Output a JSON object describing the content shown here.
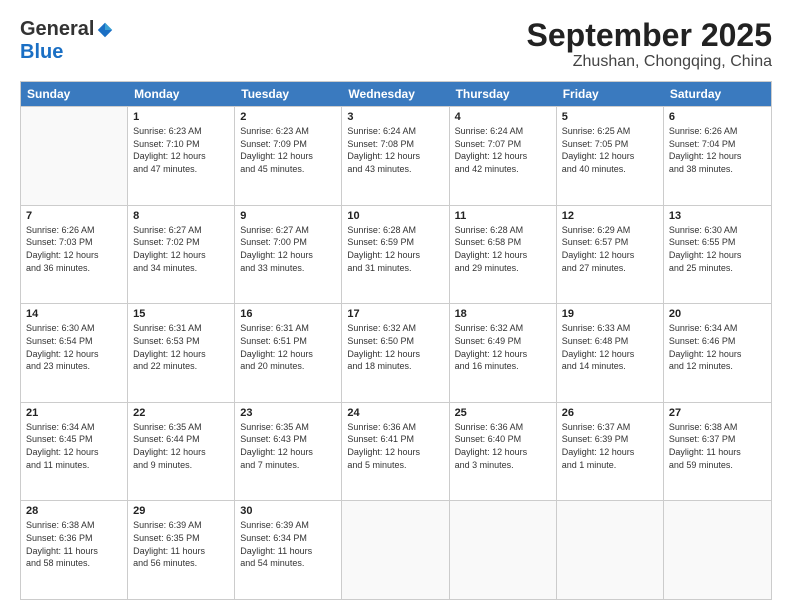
{
  "header": {
    "logo_general": "General",
    "logo_blue": "Blue",
    "month_title": "September 2025",
    "location": "Zhushan, Chongqing, China"
  },
  "weekdays": [
    "Sunday",
    "Monday",
    "Tuesday",
    "Wednesday",
    "Thursday",
    "Friday",
    "Saturday"
  ],
  "weeks": [
    [
      {
        "day": "",
        "info": ""
      },
      {
        "day": "1",
        "info": "Sunrise: 6:23 AM\nSunset: 7:10 PM\nDaylight: 12 hours\nand 47 minutes."
      },
      {
        "day": "2",
        "info": "Sunrise: 6:23 AM\nSunset: 7:09 PM\nDaylight: 12 hours\nand 45 minutes."
      },
      {
        "day": "3",
        "info": "Sunrise: 6:24 AM\nSunset: 7:08 PM\nDaylight: 12 hours\nand 43 minutes."
      },
      {
        "day": "4",
        "info": "Sunrise: 6:24 AM\nSunset: 7:07 PM\nDaylight: 12 hours\nand 42 minutes."
      },
      {
        "day": "5",
        "info": "Sunrise: 6:25 AM\nSunset: 7:05 PM\nDaylight: 12 hours\nand 40 minutes."
      },
      {
        "day": "6",
        "info": "Sunrise: 6:26 AM\nSunset: 7:04 PM\nDaylight: 12 hours\nand 38 minutes."
      }
    ],
    [
      {
        "day": "7",
        "info": "Sunrise: 6:26 AM\nSunset: 7:03 PM\nDaylight: 12 hours\nand 36 minutes."
      },
      {
        "day": "8",
        "info": "Sunrise: 6:27 AM\nSunset: 7:02 PM\nDaylight: 12 hours\nand 34 minutes."
      },
      {
        "day": "9",
        "info": "Sunrise: 6:27 AM\nSunset: 7:00 PM\nDaylight: 12 hours\nand 33 minutes."
      },
      {
        "day": "10",
        "info": "Sunrise: 6:28 AM\nSunset: 6:59 PM\nDaylight: 12 hours\nand 31 minutes."
      },
      {
        "day": "11",
        "info": "Sunrise: 6:28 AM\nSunset: 6:58 PM\nDaylight: 12 hours\nand 29 minutes."
      },
      {
        "day": "12",
        "info": "Sunrise: 6:29 AM\nSunset: 6:57 PM\nDaylight: 12 hours\nand 27 minutes."
      },
      {
        "day": "13",
        "info": "Sunrise: 6:30 AM\nSunset: 6:55 PM\nDaylight: 12 hours\nand 25 minutes."
      }
    ],
    [
      {
        "day": "14",
        "info": "Sunrise: 6:30 AM\nSunset: 6:54 PM\nDaylight: 12 hours\nand 23 minutes."
      },
      {
        "day": "15",
        "info": "Sunrise: 6:31 AM\nSunset: 6:53 PM\nDaylight: 12 hours\nand 22 minutes."
      },
      {
        "day": "16",
        "info": "Sunrise: 6:31 AM\nSunset: 6:51 PM\nDaylight: 12 hours\nand 20 minutes."
      },
      {
        "day": "17",
        "info": "Sunrise: 6:32 AM\nSunset: 6:50 PM\nDaylight: 12 hours\nand 18 minutes."
      },
      {
        "day": "18",
        "info": "Sunrise: 6:32 AM\nSunset: 6:49 PM\nDaylight: 12 hours\nand 16 minutes."
      },
      {
        "day": "19",
        "info": "Sunrise: 6:33 AM\nSunset: 6:48 PM\nDaylight: 12 hours\nand 14 minutes."
      },
      {
        "day": "20",
        "info": "Sunrise: 6:34 AM\nSunset: 6:46 PM\nDaylight: 12 hours\nand 12 minutes."
      }
    ],
    [
      {
        "day": "21",
        "info": "Sunrise: 6:34 AM\nSunset: 6:45 PM\nDaylight: 12 hours\nand 11 minutes."
      },
      {
        "day": "22",
        "info": "Sunrise: 6:35 AM\nSunset: 6:44 PM\nDaylight: 12 hours\nand 9 minutes."
      },
      {
        "day": "23",
        "info": "Sunrise: 6:35 AM\nSunset: 6:43 PM\nDaylight: 12 hours\nand 7 minutes."
      },
      {
        "day": "24",
        "info": "Sunrise: 6:36 AM\nSunset: 6:41 PM\nDaylight: 12 hours\nand 5 minutes."
      },
      {
        "day": "25",
        "info": "Sunrise: 6:36 AM\nSunset: 6:40 PM\nDaylight: 12 hours\nand 3 minutes."
      },
      {
        "day": "26",
        "info": "Sunrise: 6:37 AM\nSunset: 6:39 PM\nDaylight: 12 hours\nand 1 minute."
      },
      {
        "day": "27",
        "info": "Sunrise: 6:38 AM\nSunset: 6:37 PM\nDaylight: 11 hours\nand 59 minutes."
      }
    ],
    [
      {
        "day": "28",
        "info": "Sunrise: 6:38 AM\nSunset: 6:36 PM\nDaylight: 11 hours\nand 58 minutes."
      },
      {
        "day": "29",
        "info": "Sunrise: 6:39 AM\nSunset: 6:35 PM\nDaylight: 11 hours\nand 56 minutes."
      },
      {
        "day": "30",
        "info": "Sunrise: 6:39 AM\nSunset: 6:34 PM\nDaylight: 11 hours\nand 54 minutes."
      },
      {
        "day": "",
        "info": ""
      },
      {
        "day": "",
        "info": ""
      },
      {
        "day": "",
        "info": ""
      },
      {
        "day": "",
        "info": ""
      }
    ]
  ]
}
